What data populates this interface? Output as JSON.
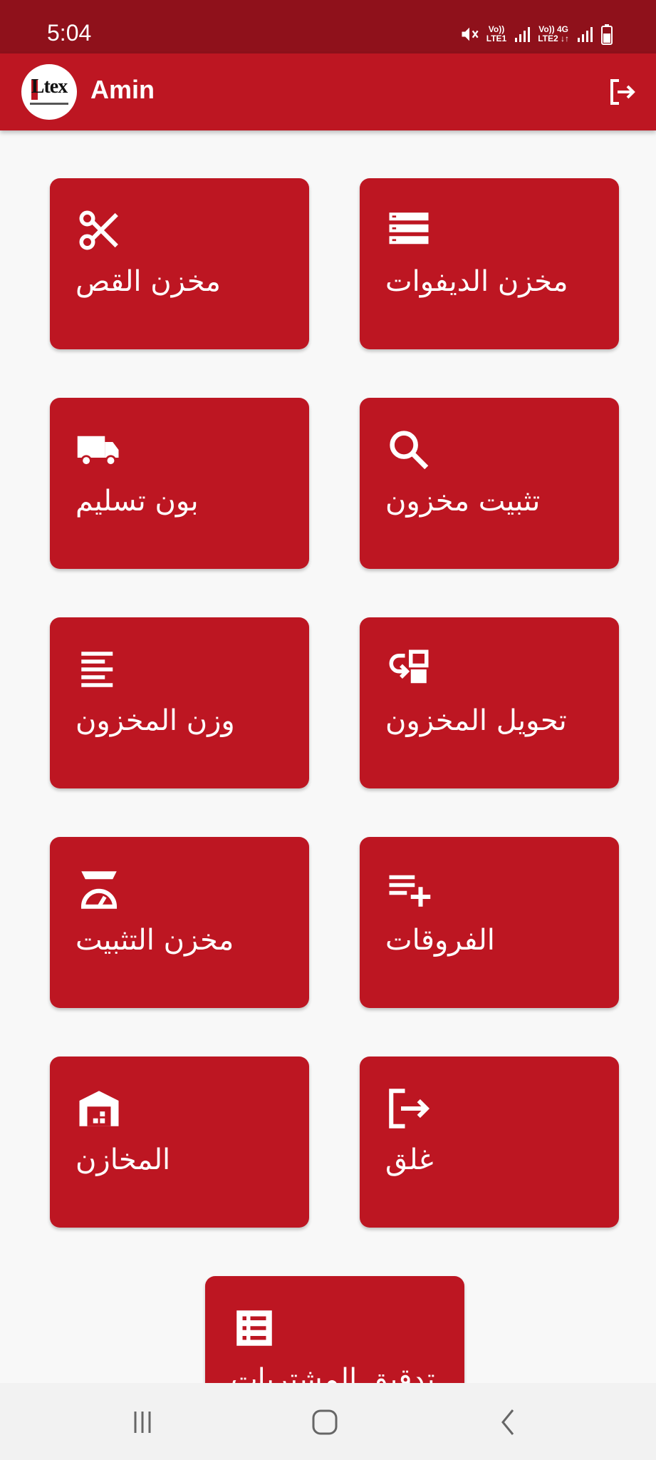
{
  "status_bar": {
    "time": "5:04",
    "sim1": {
      "top": "Vo))",
      "bottom": "LTE1"
    },
    "sim2": {
      "top": "Vo)) 4G",
      "bottom": "LTE2 ↓↑"
    },
    "icons": [
      "mute-icon",
      "signal-icon",
      "signal-icon",
      "battery-icon"
    ]
  },
  "app_bar": {
    "logo_text": "Ltex",
    "user_name": "Amin",
    "logout_icon": "logout-icon"
  },
  "tiles": [
    {
      "label": "مخزن الديفوات",
      "icon": "storage-list-icon"
    },
    {
      "label": "مخزن القص",
      "icon": "scissors-icon"
    },
    {
      "label": "تثبيت مخزون",
      "icon": "search-icon"
    },
    {
      "label": "بون تسليم",
      "icon": "truck-icon"
    },
    {
      "label": "تحويل المخزون",
      "icon": "transfer-icon"
    },
    {
      "label": "وزن المخزون",
      "icon": "lines-icon"
    },
    {
      "label": "الفروقات",
      "icon": "playlist-add-icon"
    },
    {
      "label": "مخزن التثبيت",
      "icon": "scale-icon"
    },
    {
      "label": "غلق",
      "icon": "exit-icon"
    },
    {
      "label": "المخازن",
      "icon": "warehouse-icon"
    },
    {
      "label": "تدقيق المشتريات",
      "icon": "checklist-icon"
    }
  ],
  "nav_bar": {
    "recents": "recents-icon",
    "home": "home-icon",
    "back": "back-icon"
  },
  "colors": {
    "status_bar": "#8f111b",
    "primary": "#bd1622",
    "background": "#f8f8f8"
  }
}
